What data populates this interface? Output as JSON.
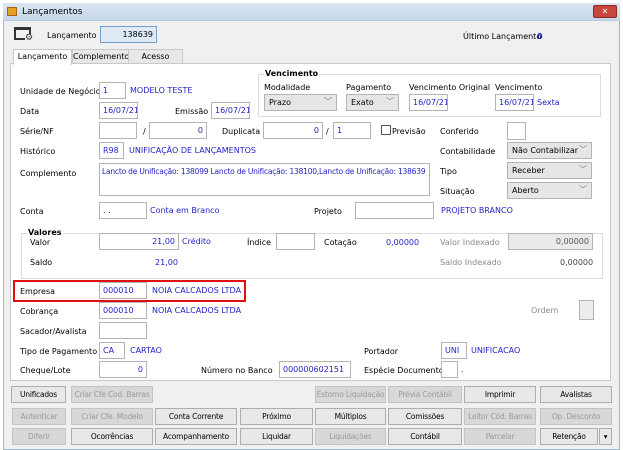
{
  "window": {
    "title": "Lançamentos",
    "close": "✕"
  },
  "header": {
    "lancamento_label": "Lançamento",
    "lancamento_value": "138639",
    "ultimo_label": "Último Lançamento",
    "ultimo_value": "0"
  },
  "tabs": [
    {
      "label": "Lançamento",
      "active": true
    },
    {
      "label": "Complemento"
    },
    {
      "label": "Acesso"
    }
  ],
  "form": {
    "unidade_label": "Unidade de Negócio",
    "unidade_code": "1",
    "unidade_name": "MODELO TESTE",
    "data_label": "Data",
    "data_value": "16/07/21",
    "emissao_label": "Emissão",
    "emissao_value": "16/07/21",
    "serie_label": "Série/NF",
    "serie_value": "",
    "nf_sep": "/",
    "nf_value": "0",
    "duplicata_label": "Duplicata",
    "duplicata_value": "0",
    "dup_sep": "/",
    "dup_parcela": "1",
    "previsao_label": "Previsão",
    "previsao_checked": false,
    "historico_label": "Histórico",
    "historico_code": "R98",
    "historico_name": "UNIFICAÇÃO DE LANÇAMENTOS",
    "complemento_label": "Complemento",
    "complemento_value": "Lancto de Unificação: 138099 Lancto de Unificação: 138100,Lancto de Unificação: 138639",
    "conta_label": "Conta",
    "conta_value": ". .",
    "conta_name": "Conta em Branco",
    "projeto_label": "Projeto",
    "projeto_value": "",
    "projeto_name": "PROJETO BRANCO",
    "empresa_label": "Empresa",
    "empresa_code": "000010",
    "empresa_name": "NOIA CALCADOS LTDA",
    "cobranca_label": "Cobrança",
    "cobranca_code": "000010",
    "cobranca_name": "NOIA CALCADOS LTDA",
    "ordem_label": "Ordem",
    "sacador_label": "Sacador/Avalista",
    "sacador_value": "",
    "tipo_pag_label": "Tipo de Pagamento",
    "tipo_pag_code": "CA",
    "tipo_pag_name": "CARTAO",
    "portador_label": "Portador",
    "portador_code": "UNI",
    "portador_name": "UNIFICACAO",
    "cheque_label": "Cheque/Lote",
    "cheque_value": "0",
    "numero_banco_label": "Número no Banco",
    "numero_banco_value": "000000602151",
    "especie_label": "Espécie Documento",
    "especie_value": "",
    "especie_dot": "."
  },
  "vencimento": {
    "title": "Vencimento",
    "modalidade_label": "Modalidade",
    "modalidade_value": "Prazo",
    "pagamento_label": "Pagamento",
    "pagamento_value": "Exato",
    "original_label": "Vencimento Original",
    "original_value": "16/07/21",
    "venc_label": "Vencimento",
    "venc_value": "16/07/21",
    "dia": "Sexta"
  },
  "right": {
    "conferido_label": "Conferido",
    "contabilidade_label": "Contabilidade",
    "contabilidade_value": "Não Contabilizar",
    "tipo_label": "Tipo",
    "tipo_value": "Receber",
    "situacao_label": "Situação",
    "situacao_value": "Aberto"
  },
  "valores": {
    "title": "Valores",
    "valor_label": "Valor",
    "valor_value": "21,00",
    "credito": "Crédito",
    "indice_label": "Índice",
    "indice_value": "",
    "cotacao_label": "Cotação",
    "cotacao_value": "0,00000",
    "valor_indexado_label": "Valor Indexado",
    "valor_indexado_value": "0,00000",
    "saldo_label": "Saldo",
    "saldo_value": "21,00",
    "saldo_indexado_label": "Saldo Indexado",
    "saldo_indexado_value": "0,00000"
  },
  "buttons": {
    "row1": [
      {
        "label": "Unificados",
        "enabled": true
      },
      {
        "label": "Criar Cfe Cod. Barras",
        "enabled": false
      },
      {
        "label": "Estorno Liquidação",
        "enabled": false
      },
      {
        "label": "Prévia Contábil",
        "enabled": false
      },
      {
        "label": "Imprimir",
        "enabled": true
      },
      {
        "label": "Avalistas",
        "enabled": true
      }
    ],
    "row2": [
      {
        "label": "Autenticar",
        "enabled": false
      },
      {
        "label": "Criar Cfe. Modelo",
        "enabled": false
      },
      {
        "label": "Conta Corrente",
        "enabled": true
      },
      {
        "label": "Próximo",
        "enabled": true
      },
      {
        "label": "Múltiplos",
        "enabled": true
      },
      {
        "label": "Comissões",
        "enabled": true
      },
      {
        "label": "Leitor Cód. Barras",
        "enabled": false
      },
      {
        "label": "Op. Desconto",
        "enabled": false
      }
    ],
    "row3": [
      {
        "label": "Diferir",
        "enabled": false
      },
      {
        "label": "Ocorrências",
        "enabled": true
      },
      {
        "label": "Acompanhamento",
        "enabled": true
      },
      {
        "label": "Liquidar",
        "enabled": true
      },
      {
        "label": "Liquidações",
        "enabled": false
      },
      {
        "label": "Contábil",
        "enabled": true
      },
      {
        "label": "Parcelar",
        "enabled": false
      },
      {
        "label": "Retenção",
        "enabled": true
      }
    ]
  },
  "colors": {
    "accent_text": "#1f1fc8",
    "highlight_box": "#e01010",
    "close_button": "#c9463d"
  }
}
